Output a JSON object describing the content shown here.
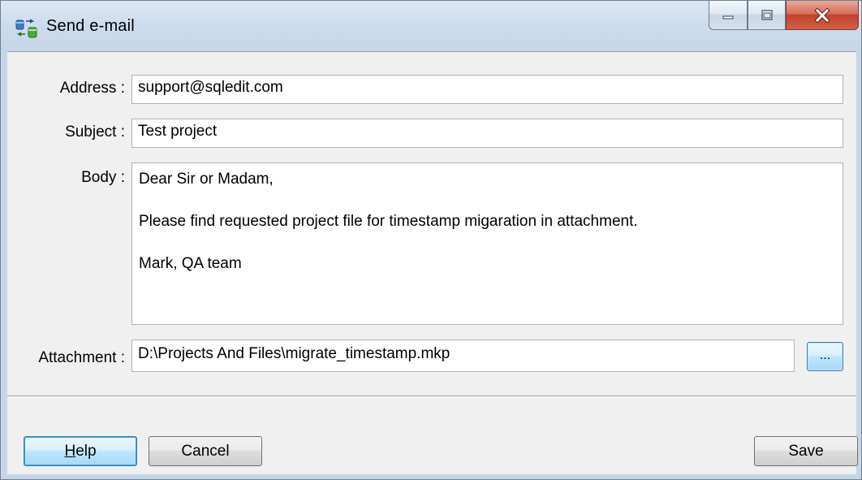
{
  "window": {
    "title": "Send e-mail",
    "controls": {
      "minimize": "minimize",
      "maximize": "maximize",
      "close": "close"
    }
  },
  "form": {
    "address_label": "Address :",
    "address_value": "support@sqledit.com",
    "subject_label": "Subject :",
    "subject_value": "Test project",
    "body_label": "Body :",
    "body_lines": [
      "Dear Sir or Madam,",
      "Please find requested project file for timestamp migaration in attachment.",
      "Mark, QA team"
    ],
    "attachment_label": "Attachment :",
    "attachment_value": "D:\\Projects And Files\\migrate_timestamp.mkp",
    "browse_label": "..."
  },
  "buttons": {
    "help_mnemonic": "H",
    "help_rest": "elp",
    "cancel": "Cancel",
    "save": "Save"
  },
  "colors": {
    "dialog_bg": "#f0f0f0",
    "title_bg": "#cddcec",
    "close_button": "#c2432a",
    "focus_blue": "#3c7fb1"
  },
  "icons": {
    "app": "database-transfer-icon",
    "minimize": "minimize-icon",
    "maximize": "maximize-icon",
    "close": "close-icon"
  }
}
